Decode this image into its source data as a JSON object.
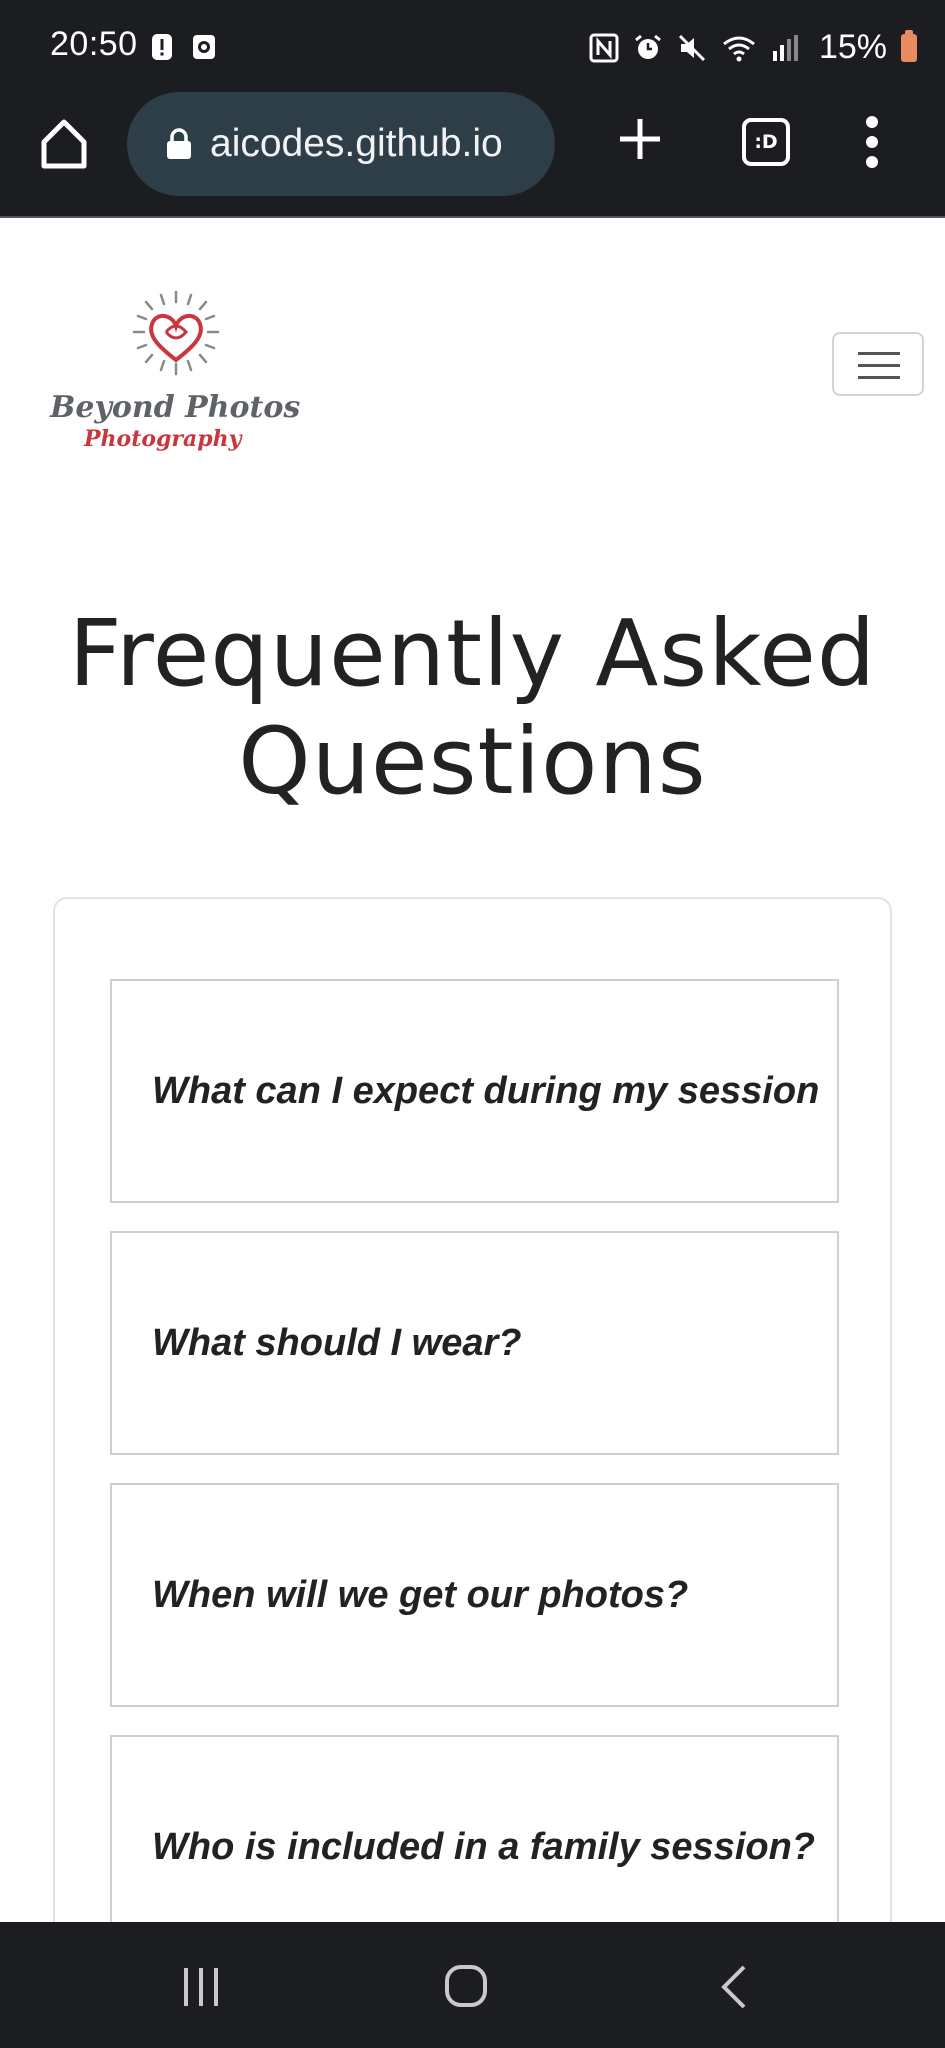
{
  "status_bar": {
    "time": "20:50",
    "battery": "15%",
    "icons": [
      "notification-alert-icon",
      "notification-app-icon",
      "nfc-icon",
      "alarm-icon",
      "mute-icon",
      "wifi-icon",
      "signal-icon",
      "battery-icon"
    ]
  },
  "browser": {
    "url": "aicodes.github.io",
    "tabs_label": ":D"
  },
  "site": {
    "logo_line1": "Beyond Photos",
    "logo_line2": "Photography",
    "title_line1": "Frequently Asked",
    "title_line2": "Questions"
  },
  "faq": {
    "items": [
      {
        "question": "What can I expect during my session"
      },
      {
        "question": "What should I wear?"
      },
      {
        "question": "When will we get our photos?"
      },
      {
        "question": "Who is included in a family session?"
      }
    ]
  },
  "colors": {
    "system_bar": "#1b1d20",
    "url_pill": "#2d3e49",
    "logo_red": "#c8373c",
    "logo_gray": "#5f6368",
    "battery": "#e98b5f"
  }
}
